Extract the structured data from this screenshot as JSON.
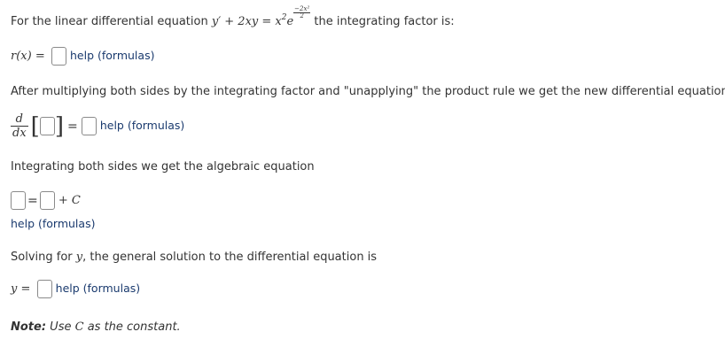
{
  "intro": {
    "prefix": "For the linear differential equation ",
    "equation_lhs": "y′ + 2xy = x",
    "power_2": "2",
    "exp_base": "e",
    "exp_num": "−2x²",
    "exp_den": "2",
    "suffix": " the integrating factor is:"
  },
  "integrating_factor": {
    "label": "r(x) =",
    "help": "help (formulas)"
  },
  "after_text": "After multiplying both sides by the integrating factor and \"unapplying\" the product rule we get the new differential equation:",
  "product_rule": {
    "d_num": "d",
    "d_den": "dx",
    "left_bracket": "[",
    "right_bracket": "]",
    "equals": "=",
    "help": "help (formulas)"
  },
  "integrating_text": "Integrating both sides we get the algebraic equation",
  "algebraic": {
    "equals": "=",
    "plus_c": "+ C",
    "help": "help (formulas)"
  },
  "solving_text": {
    "prefix": "Solving for ",
    "var": "y",
    "suffix": ", the general solution to the differential equation is"
  },
  "general_solution": {
    "label": "y =",
    "help": "help (formulas)"
  },
  "note": {
    "bold": "Note:",
    "text_before": " Use ",
    "constant": "C",
    "text_after": " as the constant."
  }
}
